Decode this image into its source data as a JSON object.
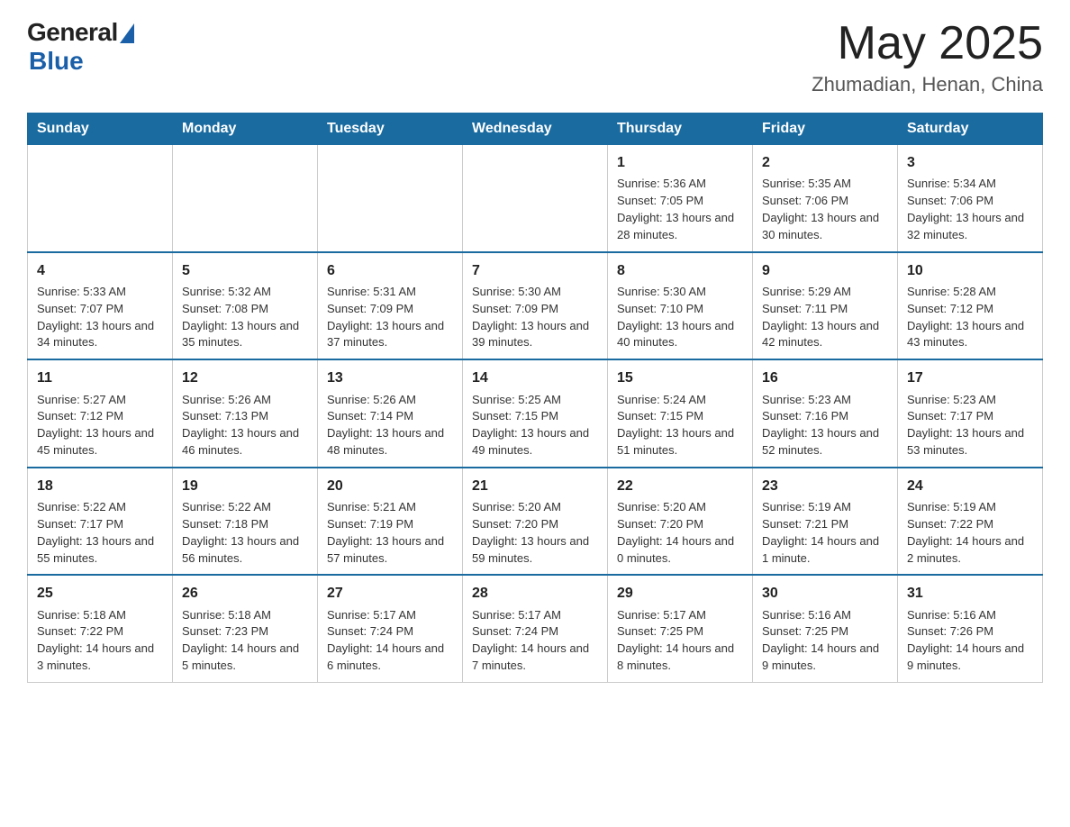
{
  "header": {
    "logo_general": "General",
    "logo_blue": "Blue",
    "month": "May 2025",
    "location": "Zhumadian, Henan, China"
  },
  "weekdays": [
    "Sunday",
    "Monday",
    "Tuesday",
    "Wednesday",
    "Thursday",
    "Friday",
    "Saturday"
  ],
  "weeks": [
    [
      {
        "day": "",
        "info": ""
      },
      {
        "day": "",
        "info": ""
      },
      {
        "day": "",
        "info": ""
      },
      {
        "day": "",
        "info": ""
      },
      {
        "day": "1",
        "info": "Sunrise: 5:36 AM\nSunset: 7:05 PM\nDaylight: 13 hours and 28 minutes."
      },
      {
        "day": "2",
        "info": "Sunrise: 5:35 AM\nSunset: 7:06 PM\nDaylight: 13 hours and 30 minutes."
      },
      {
        "day": "3",
        "info": "Sunrise: 5:34 AM\nSunset: 7:06 PM\nDaylight: 13 hours and 32 minutes."
      }
    ],
    [
      {
        "day": "4",
        "info": "Sunrise: 5:33 AM\nSunset: 7:07 PM\nDaylight: 13 hours and 34 minutes."
      },
      {
        "day": "5",
        "info": "Sunrise: 5:32 AM\nSunset: 7:08 PM\nDaylight: 13 hours and 35 minutes."
      },
      {
        "day": "6",
        "info": "Sunrise: 5:31 AM\nSunset: 7:09 PM\nDaylight: 13 hours and 37 minutes."
      },
      {
        "day": "7",
        "info": "Sunrise: 5:30 AM\nSunset: 7:09 PM\nDaylight: 13 hours and 39 minutes."
      },
      {
        "day": "8",
        "info": "Sunrise: 5:30 AM\nSunset: 7:10 PM\nDaylight: 13 hours and 40 minutes."
      },
      {
        "day": "9",
        "info": "Sunrise: 5:29 AM\nSunset: 7:11 PM\nDaylight: 13 hours and 42 minutes."
      },
      {
        "day": "10",
        "info": "Sunrise: 5:28 AM\nSunset: 7:12 PM\nDaylight: 13 hours and 43 minutes."
      }
    ],
    [
      {
        "day": "11",
        "info": "Sunrise: 5:27 AM\nSunset: 7:12 PM\nDaylight: 13 hours and 45 minutes."
      },
      {
        "day": "12",
        "info": "Sunrise: 5:26 AM\nSunset: 7:13 PM\nDaylight: 13 hours and 46 minutes."
      },
      {
        "day": "13",
        "info": "Sunrise: 5:26 AM\nSunset: 7:14 PM\nDaylight: 13 hours and 48 minutes."
      },
      {
        "day": "14",
        "info": "Sunrise: 5:25 AM\nSunset: 7:15 PM\nDaylight: 13 hours and 49 minutes."
      },
      {
        "day": "15",
        "info": "Sunrise: 5:24 AM\nSunset: 7:15 PM\nDaylight: 13 hours and 51 minutes."
      },
      {
        "day": "16",
        "info": "Sunrise: 5:23 AM\nSunset: 7:16 PM\nDaylight: 13 hours and 52 minutes."
      },
      {
        "day": "17",
        "info": "Sunrise: 5:23 AM\nSunset: 7:17 PM\nDaylight: 13 hours and 53 minutes."
      }
    ],
    [
      {
        "day": "18",
        "info": "Sunrise: 5:22 AM\nSunset: 7:17 PM\nDaylight: 13 hours and 55 minutes."
      },
      {
        "day": "19",
        "info": "Sunrise: 5:22 AM\nSunset: 7:18 PM\nDaylight: 13 hours and 56 minutes."
      },
      {
        "day": "20",
        "info": "Sunrise: 5:21 AM\nSunset: 7:19 PM\nDaylight: 13 hours and 57 minutes."
      },
      {
        "day": "21",
        "info": "Sunrise: 5:20 AM\nSunset: 7:20 PM\nDaylight: 13 hours and 59 minutes."
      },
      {
        "day": "22",
        "info": "Sunrise: 5:20 AM\nSunset: 7:20 PM\nDaylight: 14 hours and 0 minutes."
      },
      {
        "day": "23",
        "info": "Sunrise: 5:19 AM\nSunset: 7:21 PM\nDaylight: 14 hours and 1 minute."
      },
      {
        "day": "24",
        "info": "Sunrise: 5:19 AM\nSunset: 7:22 PM\nDaylight: 14 hours and 2 minutes."
      }
    ],
    [
      {
        "day": "25",
        "info": "Sunrise: 5:18 AM\nSunset: 7:22 PM\nDaylight: 14 hours and 3 minutes."
      },
      {
        "day": "26",
        "info": "Sunrise: 5:18 AM\nSunset: 7:23 PM\nDaylight: 14 hours and 5 minutes."
      },
      {
        "day": "27",
        "info": "Sunrise: 5:17 AM\nSunset: 7:24 PM\nDaylight: 14 hours and 6 minutes."
      },
      {
        "day": "28",
        "info": "Sunrise: 5:17 AM\nSunset: 7:24 PM\nDaylight: 14 hours and 7 minutes."
      },
      {
        "day": "29",
        "info": "Sunrise: 5:17 AM\nSunset: 7:25 PM\nDaylight: 14 hours and 8 minutes."
      },
      {
        "day": "30",
        "info": "Sunrise: 5:16 AM\nSunset: 7:25 PM\nDaylight: 14 hours and 9 minutes."
      },
      {
        "day": "31",
        "info": "Sunrise: 5:16 AM\nSunset: 7:26 PM\nDaylight: 14 hours and 9 minutes."
      }
    ]
  ]
}
